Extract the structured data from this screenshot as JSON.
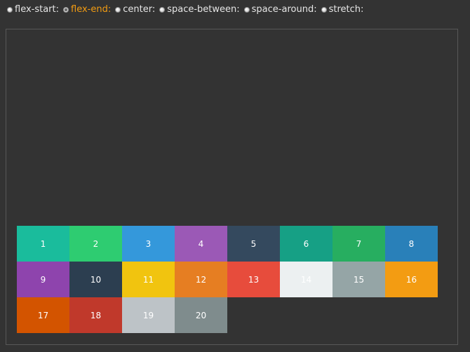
{
  "options": [
    {
      "label": "flex-start:",
      "selected": false
    },
    {
      "label": "flex-end:",
      "selected": true
    },
    {
      "label": "center:",
      "selected": false
    },
    {
      "label": "space-between:",
      "selected": false
    },
    {
      "label": "space-around:",
      "selected": false
    },
    {
      "label": "stretch:",
      "selected": false
    }
  ],
  "colors": {
    "selected_label": "#f39c12",
    "background": "#333333",
    "border": "#585858"
  },
  "items": [
    {
      "label": "1",
      "color": "#1abc9c"
    },
    {
      "label": "2",
      "color": "#2ecc71"
    },
    {
      "label": "3",
      "color": "#3498db"
    },
    {
      "label": "4",
      "color": "#9b59b6"
    },
    {
      "label": "5",
      "color": "#34495e"
    },
    {
      "label": "6",
      "color": "#16a085"
    },
    {
      "label": "7",
      "color": "#27ae60"
    },
    {
      "label": "8",
      "color": "#2980b9"
    },
    {
      "label": "9",
      "color": "#8e44ad"
    },
    {
      "label": "10",
      "color": "#2c3e50"
    },
    {
      "label": "11",
      "color": "#f1c40f"
    },
    {
      "label": "12",
      "color": "#e67e22"
    },
    {
      "label": "13",
      "color": "#e74c3c"
    },
    {
      "label": "14",
      "color": "#ecf0f1"
    },
    {
      "label": "15",
      "color": "#95a5a6"
    },
    {
      "label": "16",
      "color": "#f39c12"
    },
    {
      "label": "17",
      "color": "#d35400"
    },
    {
      "label": "18",
      "color": "#c0392b"
    },
    {
      "label": "19",
      "color": "#bdc3c7"
    },
    {
      "label": "20",
      "color": "#7f8c8d"
    }
  ]
}
